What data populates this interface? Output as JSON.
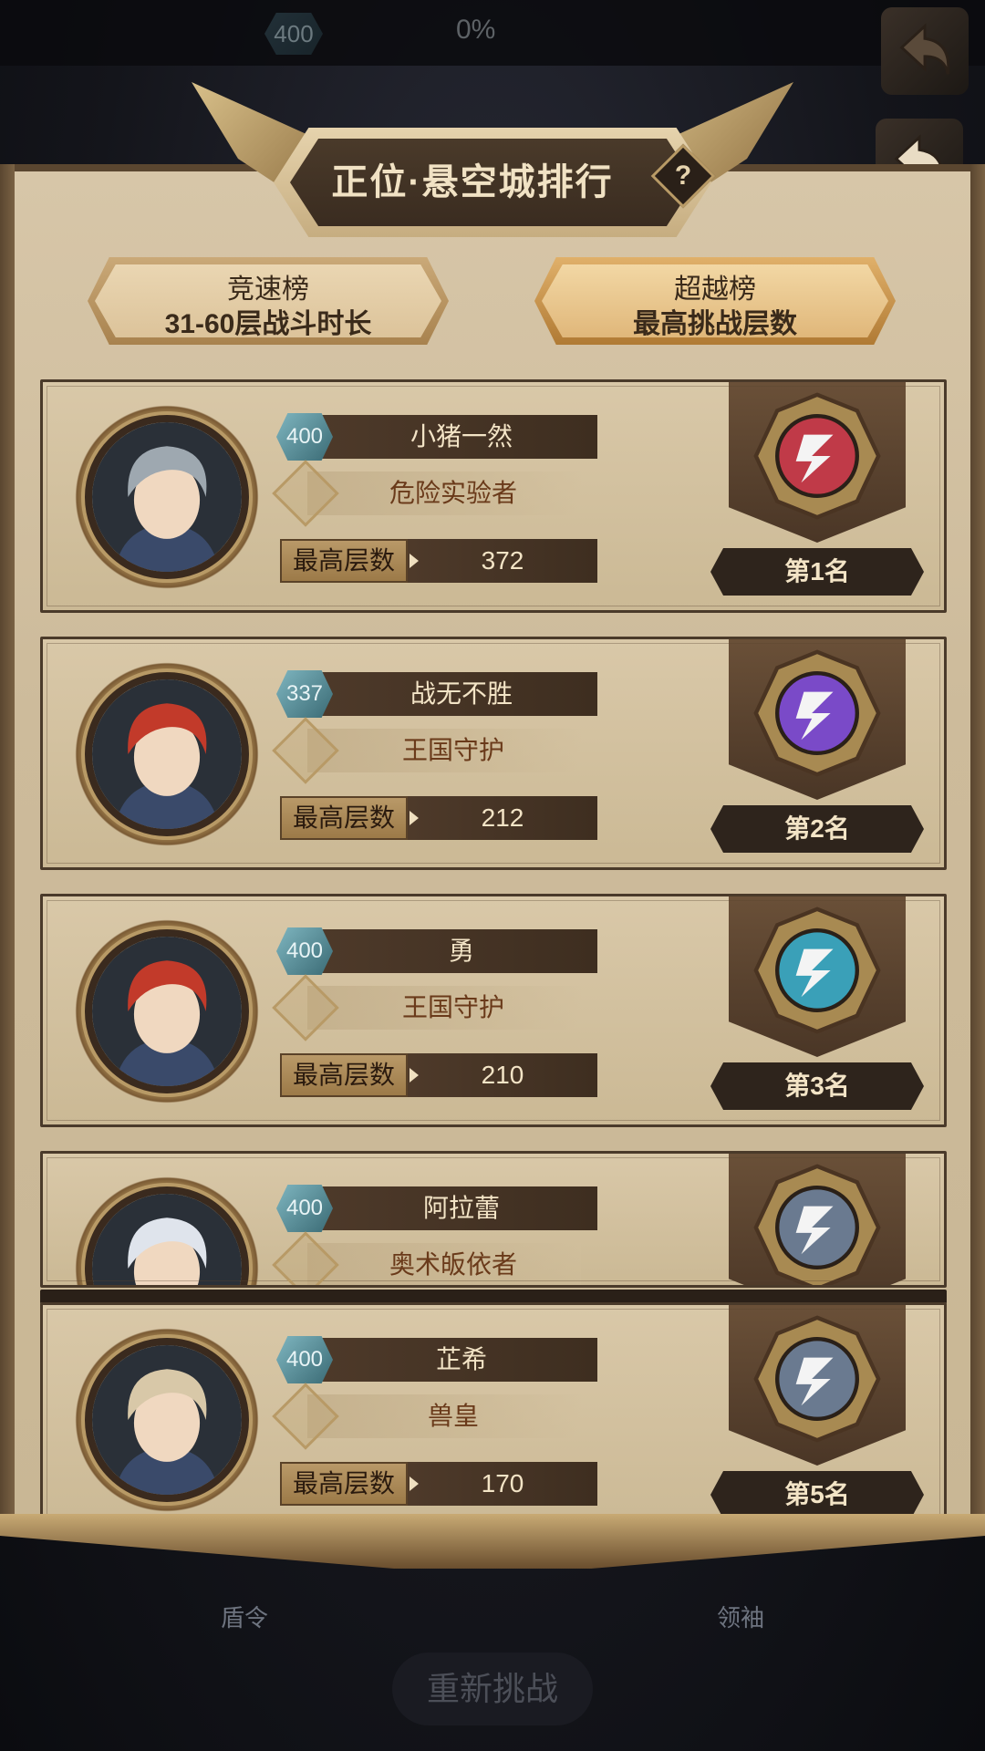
{
  "topbar": {
    "level": "400",
    "progress": "0%"
  },
  "header": {
    "title": "正位·悬空城排行",
    "help": "?"
  },
  "tabs": [
    {
      "title": "竞速榜",
      "subtitle": "31-60层战斗时长",
      "active": false
    },
    {
      "title": "超越榜",
      "subtitle": "最高挑战层数",
      "active": true
    }
  ],
  "floors_label": "最高层数",
  "rows": [
    {
      "level": "400",
      "name": "小猪一然",
      "title": "危险实验者",
      "floors": "372",
      "rank": "第1名",
      "emblem_color": "#c03a48",
      "hair": "#9ea8b0"
    },
    {
      "level": "337",
      "name": "战无不胜",
      "title": "王国守护",
      "floors": "212",
      "rank": "第2名",
      "emblem_color": "#7a4ac8",
      "hair": "#c23a2a"
    },
    {
      "level": "400",
      "name": "勇",
      "title": "王国守护",
      "floors": "210",
      "rank": "第3名",
      "emblem_color": "#3aa0b8",
      "hair": "#c23a2a"
    },
    {
      "level": "400",
      "name": "阿拉蕾",
      "title": "奥术皈依者",
      "floors": "",
      "rank": "",
      "emblem_color": "#6a7a90",
      "hair": "#dfe4ec"
    },
    {
      "level": "400",
      "name": "芷希",
      "title": "兽皇",
      "floors": "170",
      "rank": "第5名",
      "emblem_color": "#6a7a90",
      "hair": "#d8c8a8"
    }
  ],
  "bottom": {
    "left": "盾令",
    "right": "领袖",
    "retry": "重新挑战"
  },
  "colors": {
    "panel": "#d7c6a8",
    "bar_dark": "#4e3a2a",
    "title_red": "#6a3a1a"
  }
}
